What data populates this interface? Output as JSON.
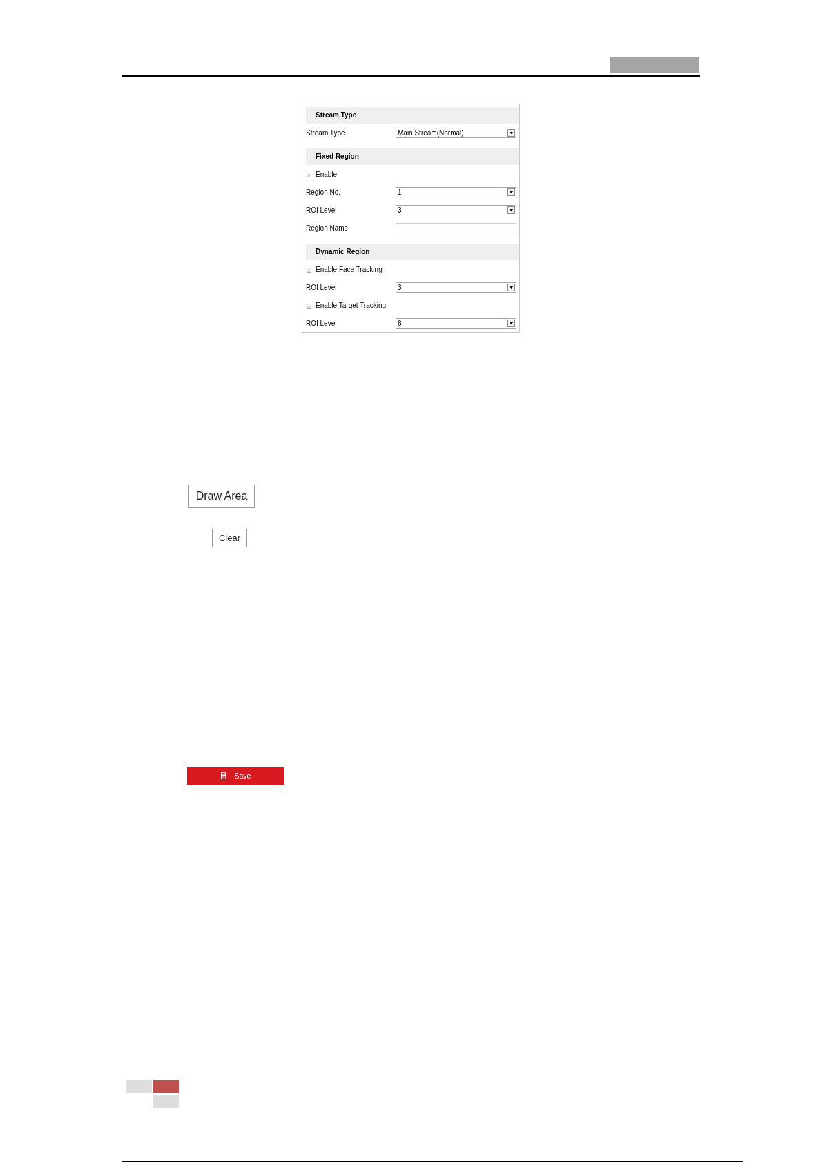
{
  "panel": {
    "sections": [
      {
        "title": "Stream Type",
        "rows": [
          {
            "kind": "select",
            "label": "Stream Type",
            "value": "Main Stream(Normal)"
          }
        ]
      },
      {
        "title": "Fixed Region",
        "rows": [
          {
            "kind": "checkbox",
            "label": "Enable",
            "checked": false
          },
          {
            "kind": "select",
            "label": "Region No.",
            "value": "1"
          },
          {
            "kind": "select",
            "label": "ROI Level",
            "value": "3"
          },
          {
            "kind": "text",
            "label": "Region Name"
          }
        ]
      },
      {
        "title": "Dynamic Region",
        "rows": [
          {
            "kind": "checkbox",
            "label": "Enable Face Tracking",
            "checked": false
          },
          {
            "kind": "select",
            "label": "ROI Level",
            "value": "3"
          },
          {
            "kind": "checkbox",
            "label": "Enable Target Tracking",
            "checked": false
          },
          {
            "kind": "select",
            "label": "ROI Level",
            "value": "6"
          }
        ]
      }
    ]
  },
  "draw_area_button": "Draw Area",
  "clear_button": "Clear",
  "save_button": "Save"
}
